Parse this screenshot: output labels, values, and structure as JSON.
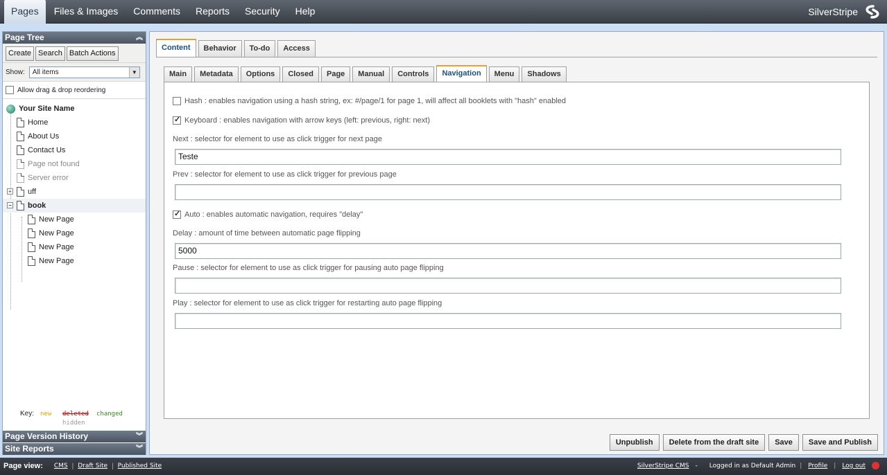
{
  "topnav": {
    "items": [
      "Pages",
      "Files & Images",
      "Comments",
      "Reports",
      "Security",
      "Help"
    ],
    "active": "Pages",
    "brand": "SilverStripe"
  },
  "sidebar": {
    "title": "Page Tree",
    "buttons": {
      "create": "Create",
      "search": "Search",
      "batch": "Batch Actions"
    },
    "show_label": "Show:",
    "show_value": "All items",
    "drag_label": "Allow drag & drop reordering",
    "tree": {
      "root": "Your Site Name",
      "items": [
        "Home",
        "About Us",
        "Contact Us",
        "Page not found",
        "Server error",
        "uff",
        "book",
        "New Page",
        "New Page",
        "New Page",
        "New Page"
      ]
    },
    "key": {
      "label": "Key:",
      "new": "new",
      "deleted": "deleted",
      "changed": "changed",
      "hidden": "hidden"
    },
    "version_history": "Page Version History",
    "site_reports": "Site Reports"
  },
  "main": {
    "tabs": [
      "Content",
      "Behavior",
      "To-do",
      "Access"
    ],
    "subtabs": [
      "Main",
      "Metadata",
      "Options",
      "Closed",
      "Page",
      "Manual",
      "Controls",
      "Navigation",
      "Menu",
      "Shadows"
    ],
    "form": {
      "hash_label": "Hash : enables navigation using a hash string, ex: #/page/1 for page 1, will affect all booklets with \"hash\" enabled",
      "keyboard_label": "Keyboard : enables navigation with arrow keys (left: previous, right: next)",
      "next_label": "Next : selector for element to use as click trigger for next page",
      "next_value": "Teste",
      "prev_label": "Prev : selector for element to use as click trigger for previous page",
      "prev_value": "",
      "auto_label": "Auto : enables automatic navigation, requires \"delay\"",
      "delay_label": "Delay : amount of time between automatic page flipping",
      "delay_value": "5000",
      "pause_label": "Pause : selector for element to use as click trigger for pausing auto page flipping",
      "pause_value": "",
      "play_label": "Play : selector for element to use as click trigger for restarting auto page flipping",
      "play_value": ""
    },
    "actions": {
      "unpublish": "Unpublish",
      "delete": "Delete from the draft site",
      "save": "Save",
      "publish": "Save and Publish"
    }
  },
  "footer": {
    "page_view": "Page view:",
    "cms": "CMS",
    "draft": "Draft Site",
    "published": "Published Site",
    "ss_cms": "SilverStripe CMS",
    "dash": "-",
    "logged_in": "Logged in as Default Admin",
    "profile": "Profile",
    "logout": "Log out"
  }
}
